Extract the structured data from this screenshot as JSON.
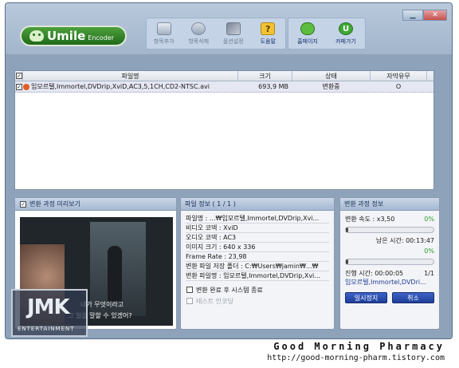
{
  "app": {
    "brand": "Umile",
    "brand_sub": "Encoder"
  },
  "toolbar": {
    "items": [
      {
        "label": "항목추가",
        "icon": "add-item-icon"
      },
      {
        "label": "항목삭제",
        "icon": "delete-item-icon"
      },
      {
        "label": "옵션설정",
        "icon": "settings-icon"
      },
      {
        "label": "도움말",
        "icon": "help-icon",
        "glyph": "?"
      },
      {
        "label": "홈페이지",
        "icon": "home-icon"
      },
      {
        "label": "카페가기",
        "icon": "cafe-icon",
        "glyph": "U"
      }
    ]
  },
  "file_list": {
    "columns": {
      "name": "파일명",
      "size": "크기",
      "status": "상태",
      "subtitle": "자막유무"
    },
    "rows": [
      {
        "name": "임모르텔,Immortel,DVDrip,XviD,AC3,5,1CH,CD2-NTSC.avi",
        "size": "693,9 MB",
        "status": "변환중",
        "subtitle": "O"
      }
    ]
  },
  "preview": {
    "title": "변환 과정 미리보기",
    "subtitle_line1": "내가 무엇이라고",
    "subtitle_line2": "그 일을 말할 수 있겠어?"
  },
  "watermark": {
    "logo": "JMK",
    "text": "ENTERTAINMENT"
  },
  "file_info": {
    "title": "파일 정보 ( 1 / 1 )",
    "lines": [
      "파일명 : ...₩임모르텔,Immortel,DVDrip,Xvi...",
      "비디오 코덱 : XviD",
      "오디오 코덱 : AC3",
      "이미지 크기 : 640 x 336",
      "Frame Rate : 23,98",
      "변환 파일 저장 폴더 : C:₩Users₩jamin₩...₩",
      "변환 파일명 : 임모르텔,Immortel,DVDrip,Xvi..."
    ],
    "shutdown_label": "변환 완료 후 시스템 종료",
    "test_encode_label": "테스트 인코딩"
  },
  "progress": {
    "title": "변환 과정 정보",
    "speed": "변환 속도 : x3,50",
    "pct_top": "0%",
    "bar_top_fraction": 0.03,
    "remaining": "남은 시간: 00:13:47",
    "pct_mid": "0%",
    "bar_mid_fraction": 0.03,
    "elapsed": "진행 시간: 00:00:05",
    "count": "1/1",
    "current_file": "임모르텔,Immortel,DVDri...",
    "pause_label": "일시정지",
    "cancel_label": "취소"
  },
  "footer": {
    "line1": "Good Morning Pharmacy",
    "line2": "http://good-morning-pharm.tistory.com"
  }
}
